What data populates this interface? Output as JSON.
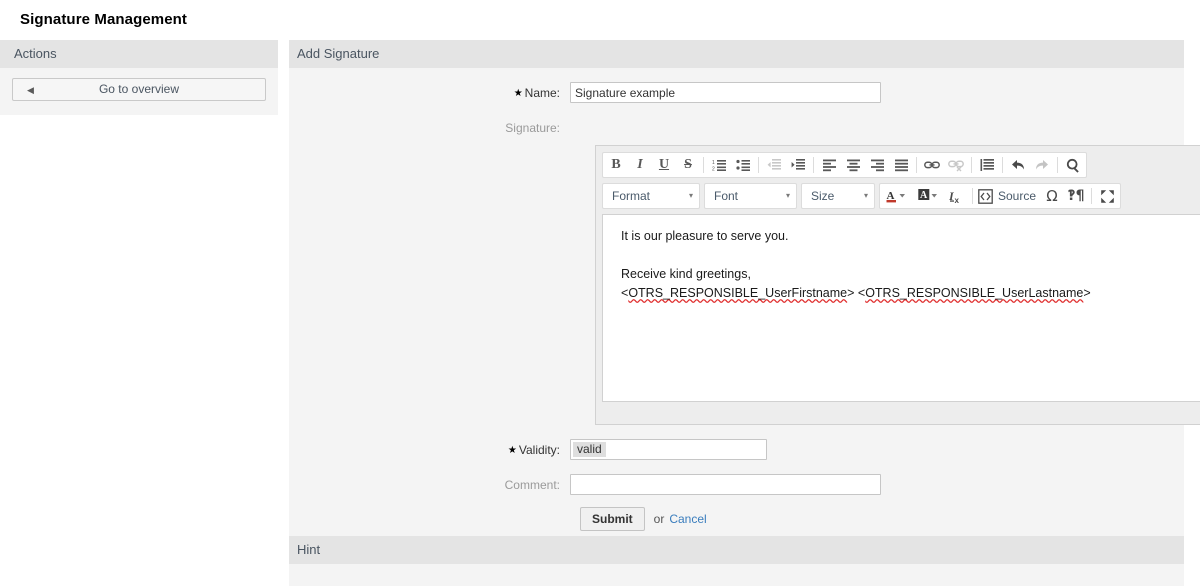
{
  "page": {
    "title": "Signature Management"
  },
  "sidebar": {
    "header": "Actions",
    "items": [
      {
        "label": "Go to overview",
        "icon": "back-arrow-icon",
        "glyph": "◀"
      }
    ]
  },
  "main": {
    "header": "Add Signature",
    "fields": {
      "name": {
        "label": "Name:",
        "required": true,
        "value": "Signature example",
        "placeholder": ""
      },
      "signature": {
        "label": "Signature:",
        "required": false
      },
      "validity": {
        "label": "Validity:",
        "required": true,
        "selected": "valid"
      },
      "comment": {
        "label": "Comment:",
        "required": false,
        "value": "",
        "placeholder": ""
      }
    },
    "actions": {
      "submit_label": "Submit",
      "or_label": "or",
      "cancel_label": "Cancel"
    }
  },
  "editor": {
    "toolbar_row1": [
      {
        "name": "bold-icon",
        "glyph": "B",
        "style": "bold",
        "disabled": false
      },
      {
        "name": "italic-icon",
        "glyph": "I",
        "style": "italic",
        "disabled": false
      },
      {
        "name": "underline-icon",
        "glyph": "U",
        "style": "underline",
        "disabled": false
      },
      {
        "name": "strikethrough-icon",
        "glyph": "S",
        "style": "strike",
        "disabled": false
      },
      {
        "name": "numbered-list-icon",
        "glyph": "",
        "style": "svg-ol",
        "disabled": false
      },
      {
        "name": "bulleted-list-icon",
        "glyph": "",
        "style": "svg-ul",
        "disabled": false
      },
      {
        "name": "outdent-icon",
        "glyph": "",
        "style": "svg-outdent",
        "disabled": true
      },
      {
        "name": "indent-icon",
        "glyph": "",
        "style": "svg-indent",
        "disabled": false
      },
      {
        "name": "align-left-icon",
        "glyph": "",
        "style": "svg-align-left",
        "disabled": false
      },
      {
        "name": "align-center-icon",
        "glyph": "",
        "style": "svg-align-center",
        "disabled": false
      },
      {
        "name": "align-right-icon",
        "glyph": "",
        "style": "svg-align-right",
        "disabled": false
      },
      {
        "name": "align-justify-icon",
        "glyph": "",
        "style": "svg-align-justify",
        "disabled": false
      },
      {
        "name": "link-icon",
        "glyph": "",
        "style": "svg-link",
        "disabled": false
      },
      {
        "name": "unlink-icon",
        "glyph": "",
        "style": "svg-unlink",
        "disabled": true
      },
      {
        "name": "blockquote-icon",
        "glyph": "",
        "style": "svg-quote",
        "disabled": false
      },
      {
        "name": "undo-icon",
        "glyph": "",
        "style": "svg-undo",
        "disabled": false
      },
      {
        "name": "redo-icon",
        "glyph": "",
        "style": "svg-redo",
        "disabled": true
      },
      {
        "name": "find-icon",
        "glyph": "",
        "style": "svg-search",
        "disabled": false
      }
    ],
    "combos": [
      {
        "name": "format-combo",
        "label": "Format",
        "caret": "▼"
      },
      {
        "name": "font-combo",
        "label": "Font",
        "caret": "▼"
      },
      {
        "name": "size-combo",
        "label": "Size",
        "caret": "▼"
      }
    ],
    "toolbar_row2": [
      {
        "name": "text-color-icon",
        "label": "",
        "style": "svg-textcolor",
        "disabled": false
      },
      {
        "name": "background-color-icon",
        "label": "",
        "style": "svg-bgcolor",
        "disabled": false
      },
      {
        "name": "remove-format-icon",
        "label": "",
        "style": "svg-removeformat",
        "disabled": false
      },
      {
        "name": "source-icon",
        "label": "Source",
        "style": "svg-source",
        "disabled": false
      },
      {
        "name": "special-character-icon",
        "label": "",
        "style": "svg-omega",
        "disabled": false
      },
      {
        "name": "bidi-icon",
        "label": "",
        "style": "svg-bidi",
        "disabled": false
      },
      {
        "name": "maximize-icon",
        "label": "",
        "style": "svg-maximize",
        "disabled": false
      }
    ],
    "source_label": "Source",
    "content": {
      "line1": "It is our pleasure to serve you.",
      "line2": "Receive kind greetings,",
      "line3_part1": "<",
      "line3_tag1": "OTRS_RESPONSIBLE_UserFirstname",
      "line3_part2": "> <",
      "line3_tag2": "OTRS_RESPONSIBLE_UserLastname",
      "line3_part3": ">"
    }
  },
  "hint": {
    "header": "Hint"
  },
  "colors": {
    "widget_header_bg": "#e4e4e4",
    "widget_body_bg": "#f4f4f4",
    "link": "#3a7dbd",
    "spellcheck_underline": "#e03030",
    "page_bg": "#ffffff"
  }
}
